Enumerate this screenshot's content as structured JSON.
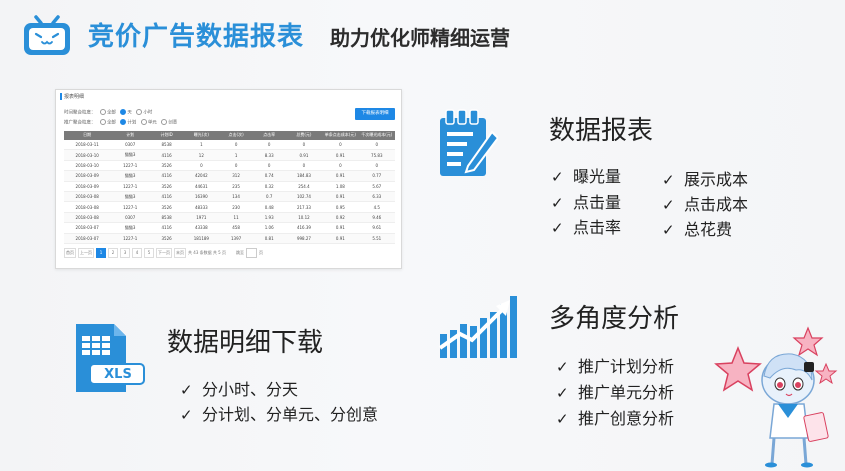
{
  "header": {
    "title_main": "竞价广告数据报表",
    "title_sub": "助力优化师精细运营",
    "accent_color": "#2a8fd8"
  },
  "report_card": {
    "title": "报表明细",
    "filter_time_label": "时间聚合粒度：",
    "filter_time_options": [
      "全部",
      "天",
      "小时"
    ],
    "filter_ad_label": "推广聚合粒度：",
    "filter_ad_options": [
      "全部",
      "计划",
      "单元",
      "创意"
    ],
    "download_button": "下载报表明细",
    "columns": [
      "日期",
      "计划",
      "计划ID",
      "曝光(次)",
      "点击(次)",
      "点击率",
      "总费(元)",
      "单条点击成本(元)",
      "千次曝光成本(元)"
    ],
    "rows": [
      [
        "2018-03-11",
        "0307",
        "8538",
        "1",
        "0",
        "0",
        "0",
        "0",
        "0"
      ],
      [
        "2018-03-10",
        "猫猫3",
        "4116",
        "12",
        "1",
        "8.33",
        "0.91",
        "0.91",
        "75.83"
      ],
      [
        "2018-03-10",
        "1227-1",
        "3526",
        "0",
        "0",
        "0",
        "0",
        "0",
        "0"
      ],
      [
        "2018-03-09",
        "猫猫3",
        "4116",
        "42042",
        "312",
        "0.74",
        "184.83",
        "0.91",
        "0.77"
      ],
      [
        "2018-03-09",
        "1227-1",
        "3526",
        "44631",
        "235",
        "0.32",
        "254.4",
        "1.08",
        "5.67"
      ],
      [
        "2018-03-08",
        "猫猫3",
        "4116",
        "16390",
        "134",
        "0.7",
        "102.74",
        "0.91",
        "6.33"
      ],
      [
        "2018-03-08",
        "1227-1",
        "3526",
        "48333",
        "230",
        "0.48",
        "217.33",
        "0.95",
        "4.5"
      ],
      [
        "2018-03-08",
        "0307",
        "8538",
        "1971",
        "11",
        "1.93",
        "10.12",
        "0.92",
        "9.46"
      ],
      [
        "2018-03-07",
        "猫猫3",
        "4116",
        "43338",
        "458",
        "1.06",
        "416.39",
        "0.91",
        "9.61"
      ],
      [
        "2018-03-07",
        "1227-1",
        "3526",
        "181189",
        "1397",
        "0.81",
        "998.27",
        "0.91",
        "5.51"
      ]
    ],
    "pager": {
      "first": "首页",
      "prev": "上一页",
      "pages": [
        "1",
        "2",
        "3",
        "4",
        "5"
      ],
      "next": "下一页",
      "last": "末页",
      "summary": "共 43 条数据 共 5 页",
      "jump": "跳至",
      "jump_unit": "页"
    }
  },
  "features": {
    "report": {
      "title": "数据报表",
      "col1": [
        "曝光量",
        "点击量",
        "点击率"
      ],
      "col2": [
        "展示成本",
        "点击成本",
        "总花费"
      ]
    },
    "download": {
      "title": "数据明细下载",
      "icon_label": "XLS",
      "items": [
        "分小时、分天",
        "分计划、分单元、分创意"
      ]
    },
    "analysis": {
      "title": "多角度分析",
      "items": [
        "推广计划分析",
        "推广单元分析",
        "推广创意分析"
      ]
    },
    "check": "✓"
  }
}
